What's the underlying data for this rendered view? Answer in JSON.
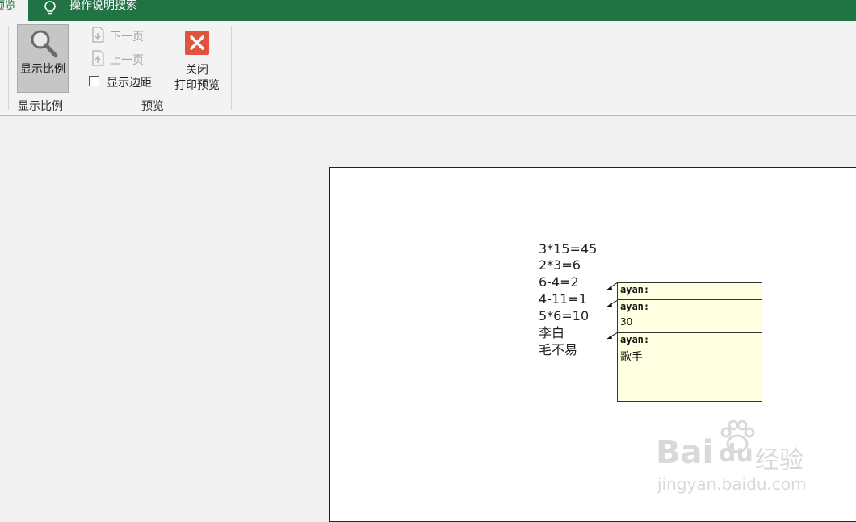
{
  "tabs": {
    "active": "预览",
    "search": "操作说明搜索"
  },
  "ribbon": {
    "zoom_button": "显示比例",
    "zoom_group": "显示比例",
    "next_page": "下一页",
    "prev_page": "上一页",
    "show_margins": "显示边距",
    "show_margins_checked": false,
    "close_line1": "关闭",
    "close_line2": "打印预览",
    "preview_group": "预览"
  },
  "document": {
    "lines": [
      "3*15=45",
      "2*3=6",
      "6-4=2",
      "4-11=1",
      "5*6=10",
      "李白",
      "毛不易"
    ]
  },
  "comments": [
    {
      "author": "ayan:",
      "text": ""
    },
    {
      "author": "ayan:",
      "text": "30"
    },
    {
      "author": "ayan:",
      "text": "歌手"
    }
  ],
  "watermark": {
    "brand": "Bai",
    "brand2": "du",
    "product": "经验",
    "url": "jingyan.baidu.com"
  },
  "colors": {
    "title_bar": "#217346",
    "close_icon": "#e2533e",
    "comment_bg": "#ffffe1"
  },
  "icons": [
    "lightbulb-icon",
    "magnifier-icon",
    "next-page-icon",
    "prev-page-icon",
    "close-x-icon",
    "paw-icon"
  ]
}
